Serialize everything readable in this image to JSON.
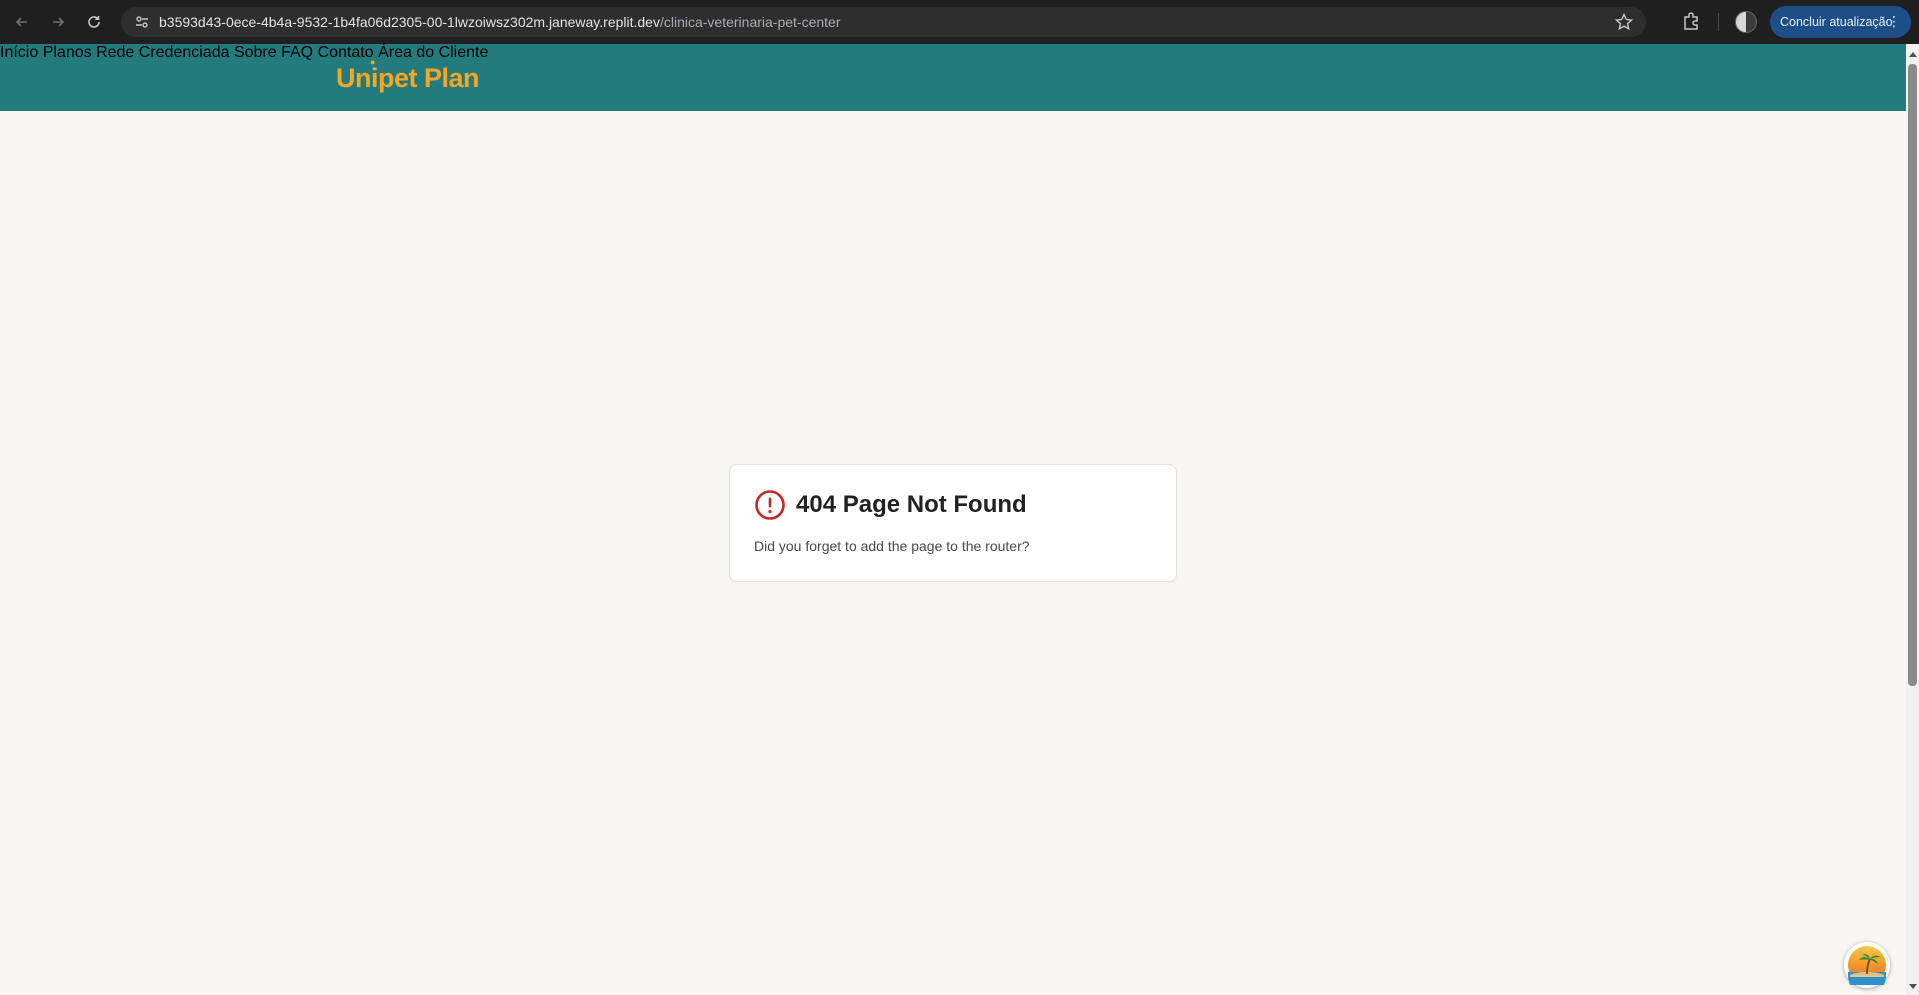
{
  "browser": {
    "url_host": "b3593d43-0ece-4b4a-9532-1b4fa06d2305-00-1lwzoiwsz302m.janeway.replit.dev",
    "url_path": "/clinica-veterinaria-pet-center",
    "update_label": "Concluir atualização"
  },
  "site": {
    "logo": "Unipet Plan",
    "nav": [
      "Início",
      "Planos",
      "Rede Credenciada",
      "Sobre",
      "FAQ",
      "Contato",
      "Área do Cliente"
    ]
  },
  "error": {
    "title": "404 Page Not Found",
    "message": "Did you forget to add the page to the router?"
  },
  "colors": {
    "header_bg": "#237b7e",
    "logo": "#f5a623",
    "alert": "#c62828"
  }
}
